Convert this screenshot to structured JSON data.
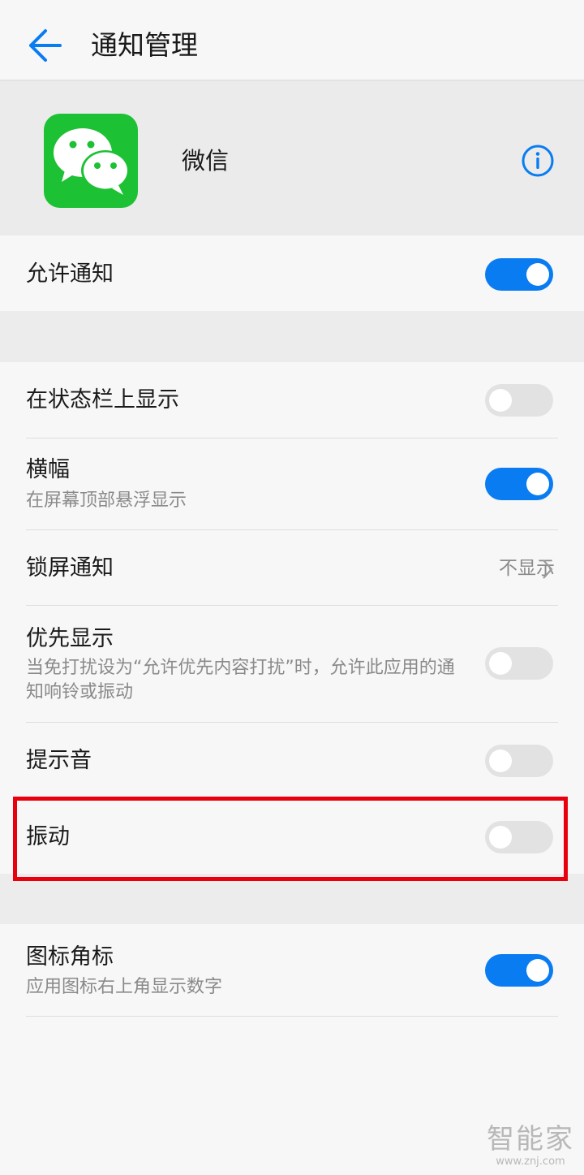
{
  "header": {
    "title": "通知管理"
  },
  "app": {
    "name": "微信"
  },
  "allow_notifications": {
    "label": "允许通知",
    "on": true
  },
  "settings": {
    "status_bar": {
      "label": "在状态栏上显示",
      "on": false
    },
    "banner": {
      "label": "横幅",
      "sublabel": "在屏幕顶部悬浮显示",
      "on": true
    },
    "lock_screen": {
      "label": "锁屏通知",
      "value": "不显示"
    },
    "priority": {
      "label": "优先显示",
      "sublabel": "当免打扰设为“允许优先内容打扰”时，允许此应用的通知响铃或振动",
      "on": false
    },
    "sound": {
      "label": "提示音",
      "on": false
    },
    "vibrate": {
      "label": "振动",
      "on": false
    }
  },
  "badge": {
    "label": "图标角标",
    "sublabel": "应用图标右上角显示数字",
    "on": true
  },
  "watermark": {
    "brand": "智能家",
    "url": "www.znj.com"
  },
  "colors": {
    "accent": "#0a7cf2",
    "wechat_green": "#1cc134",
    "highlight": "#e8000d"
  }
}
